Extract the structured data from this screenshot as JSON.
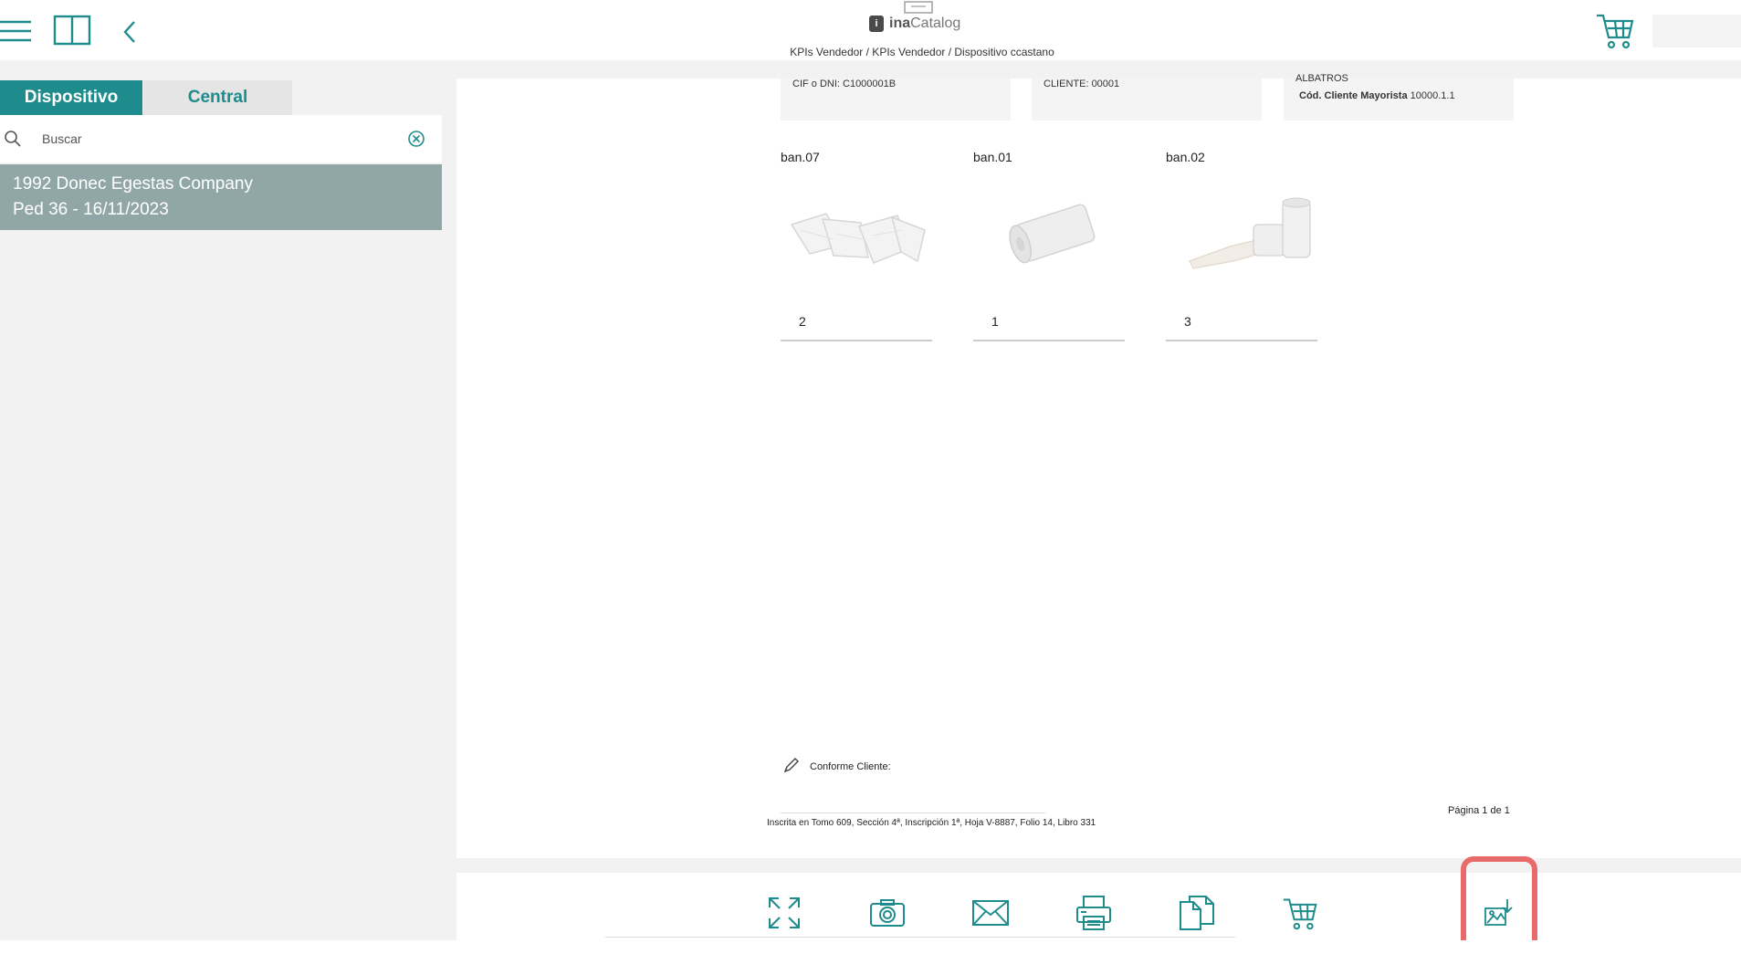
{
  "app": {
    "brand_prefix": "ina",
    "brand_suffix": "Catalog",
    "breadcrumb": "KPIs Vendedor / KPIs Vendedor / Dispositivo ccastano"
  },
  "sidebar": {
    "tabs": [
      {
        "label": "Dispositivo",
        "active": true
      },
      {
        "label": "Central",
        "active": false
      }
    ],
    "search": {
      "placeholder": "Buscar",
      "value": ""
    },
    "items": [
      {
        "line1": "1992 Donec Egestas Company",
        "line2": "Ped 36 - 16/11/2023"
      }
    ]
  },
  "document": {
    "info": {
      "cif": "CIF o DNI: C1000001B",
      "cliente": "CLIENTE: 00001",
      "albatros": "ALBATROS",
      "cod_label": "Cód. Cliente Mayorista",
      "cod_value": "10000.1.1"
    },
    "products": [
      {
        "code": "ban.07",
        "qty": "2",
        "image": "folded-gauze"
      },
      {
        "code": "ban.01",
        "qty": "1",
        "image": "bandage-roll"
      },
      {
        "code": "ban.02",
        "qty": "3",
        "image": "unrolled-bandage"
      }
    ],
    "signature_label": "Conforme Cliente:",
    "footer_note": "Inscrita en Tomo 609, Sección 4ª, Inscripción 1ª, Hoja V-8887, Folio 14, Libro 331",
    "page_label": "Página 1 de 1"
  },
  "toolbar": {
    "tools": [
      "expand-icon",
      "camera-icon",
      "email-icon",
      "printer-icon",
      "copy-document-icon",
      "cart-icon",
      "export-image-icon"
    ]
  },
  "colors": {
    "accent": "#1e8c8c",
    "selected_row": "#91a7a7",
    "highlight": "#e96a6a"
  }
}
